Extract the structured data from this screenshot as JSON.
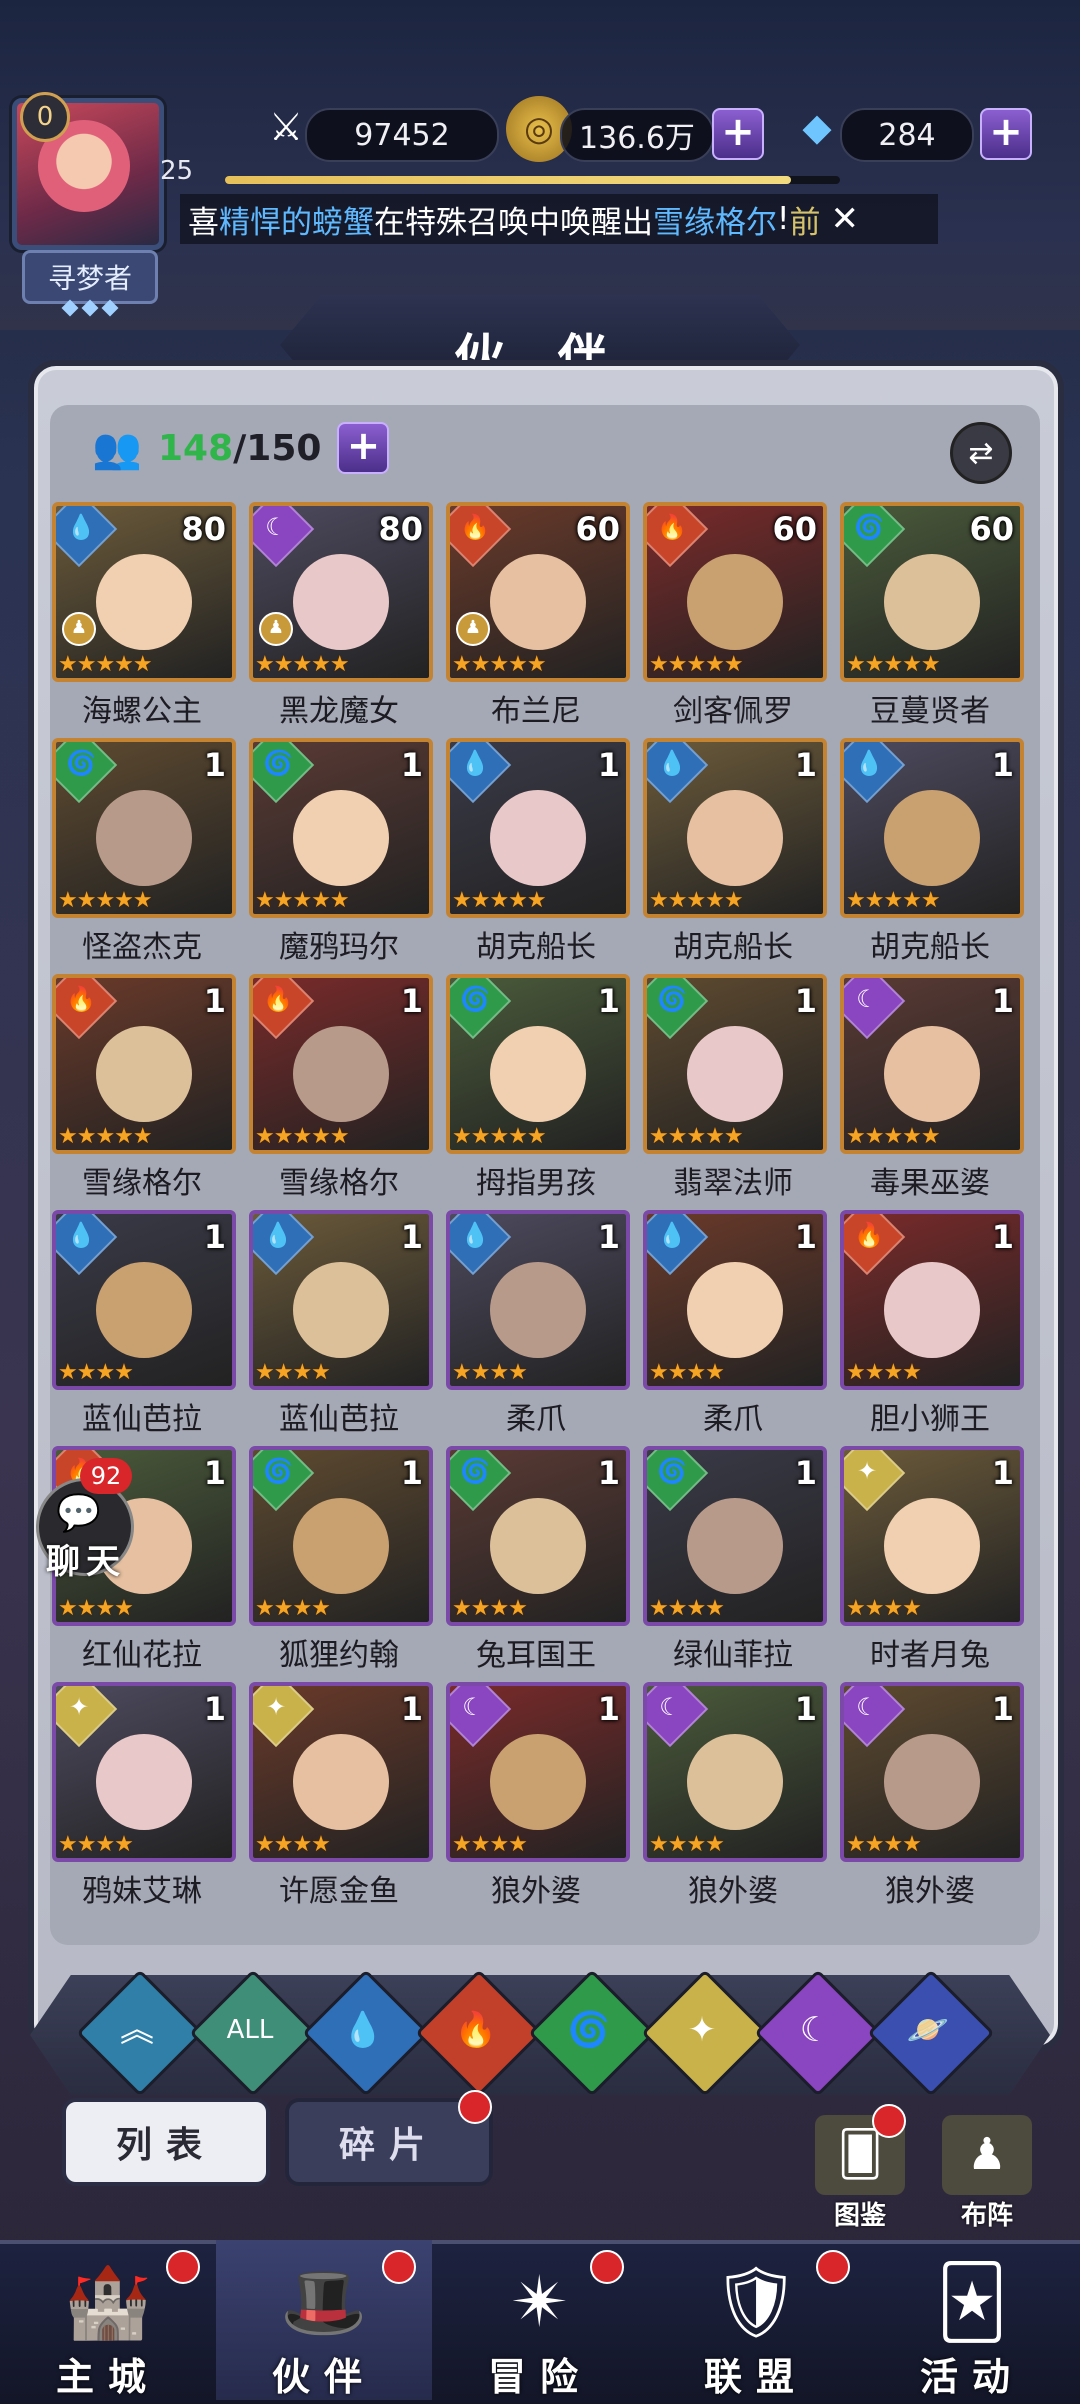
{
  "player": {
    "avatar_level": "0",
    "level": "25",
    "title": "寻梦者"
  },
  "resources": {
    "power": "97452",
    "gold": "136.6万",
    "diamonds": "284",
    "exp_fraction": 0.92
  },
  "broadcast": {
    "prefix": "喜",
    "player_name": "精悍的螃蟹",
    "middle": "在特殊召唤中唤醒出",
    "hero_name": "雪缘格尔",
    "bang": "!",
    "tag": "前"
  },
  "page_title": "伙 伴",
  "roster": {
    "current": "148",
    "max": "/150"
  },
  "heroes": [
    {
      "name": "海螺公主",
      "level": "80",
      "element": "water",
      "frame": "gold",
      "stars": 5,
      "chess": true
    },
    {
      "name": "黑龙魔女",
      "level": "80",
      "element": "moon",
      "frame": "gold",
      "stars": 5,
      "chess": true
    },
    {
      "name": "布兰尼",
      "level": "60",
      "element": "fire",
      "frame": "gold",
      "stars": 5,
      "chess": true
    },
    {
      "name": "剑客佩罗",
      "level": "60",
      "element": "fire",
      "frame": "gold",
      "stars": 5,
      "chess": false
    },
    {
      "name": "豆蔓贤者",
      "level": "60",
      "element": "wind",
      "frame": "gold",
      "stars": 5,
      "chess": false
    },
    {
      "name": "怪盗杰克",
      "level": "1",
      "element": "wind",
      "frame": "gold",
      "stars": 5,
      "chess": false
    },
    {
      "name": "魔鸦玛尔",
      "level": "1",
      "element": "wind",
      "frame": "gold",
      "stars": 5,
      "chess": false
    },
    {
      "name": "胡克船长",
      "level": "1",
      "element": "water",
      "frame": "gold",
      "stars": 5,
      "chess": false
    },
    {
      "name": "胡克船长",
      "level": "1",
      "element": "water",
      "frame": "gold",
      "stars": 5,
      "chess": false
    },
    {
      "name": "胡克船长",
      "level": "1",
      "element": "water",
      "frame": "gold",
      "stars": 5,
      "chess": false
    },
    {
      "name": "雪缘格尔",
      "level": "1",
      "element": "fire",
      "frame": "gold",
      "stars": 5,
      "chess": false
    },
    {
      "name": "雪缘格尔",
      "level": "1",
      "element": "fire",
      "frame": "gold",
      "stars": 5,
      "chess": false
    },
    {
      "name": "拇指男孩",
      "level": "1",
      "element": "wind",
      "frame": "gold",
      "stars": 5,
      "chess": false
    },
    {
      "name": "翡翠法师",
      "level": "1",
      "element": "wind",
      "frame": "gold",
      "stars": 5,
      "chess": false
    },
    {
      "name": "毒果巫婆",
      "level": "1",
      "element": "moon",
      "frame": "gold",
      "stars": 5,
      "chess": false
    },
    {
      "name": "蓝仙芭拉",
      "level": "1",
      "element": "water",
      "frame": "purple",
      "stars": 4,
      "chess": false
    },
    {
      "name": "蓝仙芭拉",
      "level": "1",
      "element": "water",
      "frame": "purple",
      "stars": 4,
      "chess": false
    },
    {
      "name": "柔爪",
      "level": "1",
      "element": "water",
      "frame": "purple",
      "stars": 4,
      "chess": false
    },
    {
      "name": "柔爪",
      "level": "1",
      "element": "water",
      "frame": "purple",
      "stars": 4,
      "chess": false
    },
    {
      "name": "胆小狮王",
      "level": "1",
      "element": "fire",
      "frame": "purple",
      "stars": 4,
      "chess": false
    },
    {
      "name": "红仙花拉",
      "level": "1",
      "element": "fire",
      "frame": "purple",
      "stars": 4,
      "chess": false
    },
    {
      "name": "狐狸约翰",
      "level": "1",
      "element": "wind",
      "frame": "purple",
      "stars": 4,
      "chess": false
    },
    {
      "name": "兔耳国王",
      "level": "1",
      "element": "wind",
      "frame": "purple",
      "stars": 4,
      "chess": false
    },
    {
      "name": "绿仙菲拉",
      "level": "1",
      "element": "wind",
      "frame": "purple",
      "stars": 4,
      "chess": false
    },
    {
      "name": "时者月兔",
      "level": "1",
      "element": "light",
      "frame": "purple",
      "stars": 4,
      "chess": false
    },
    {
      "name": "鸦妹艾琳",
      "level": "1",
      "element": "light",
      "frame": "purple",
      "stars": 4,
      "chess": false
    },
    {
      "name": "许愿金鱼",
      "level": "1",
      "element": "light",
      "frame": "purple",
      "stars": 4,
      "chess": false
    },
    {
      "name": "狼外婆",
      "level": "1",
      "element": "moon",
      "frame": "purple",
      "stars": 4,
      "chess": false
    },
    {
      "name": "狼外婆",
      "level": "1",
      "element": "moon",
      "frame": "purple",
      "stars": 4,
      "chess": false
    },
    {
      "name": "狼外婆",
      "level": "1",
      "element": "moon",
      "frame": "purple",
      "stars": 4,
      "chess": false
    }
  ],
  "filters": [
    {
      "id": "leader",
      "glyph": "︽",
      "color": "#2f7fa8"
    },
    {
      "id": "all",
      "glyph": "ALL",
      "color": "#3f8f78"
    },
    {
      "id": "water",
      "glyph": "💧",
      "color": "#2f6fb8"
    },
    {
      "id": "fire",
      "glyph": "🔥",
      "color": "#c2402a"
    },
    {
      "id": "wind",
      "glyph": "🌀",
      "color": "#2f9a4a"
    },
    {
      "id": "light",
      "glyph": "✦",
      "color": "#c9b24a"
    },
    {
      "id": "moon",
      "glyph": "☾",
      "color": "#8a45c0"
    },
    {
      "id": "void",
      "glyph": "🪐",
      "color": "#3b4fb0"
    }
  ],
  "tabs": {
    "list": "列表",
    "shards": "碎片"
  },
  "side_buttons": {
    "codex": "图鉴",
    "formation": "布阵"
  },
  "chat": {
    "badge": "92",
    "label": "聊天"
  },
  "nav": {
    "castle": "主城",
    "partners": "伙伴",
    "adventure": "冒险",
    "alliance": "联盟",
    "events": "活动"
  },
  "element_colors": {
    "water": "#2f6fb8",
    "fire": "#c8452a",
    "wind": "#2f9a4a",
    "moon": "#8a45c0",
    "light": "#c9b24a"
  }
}
